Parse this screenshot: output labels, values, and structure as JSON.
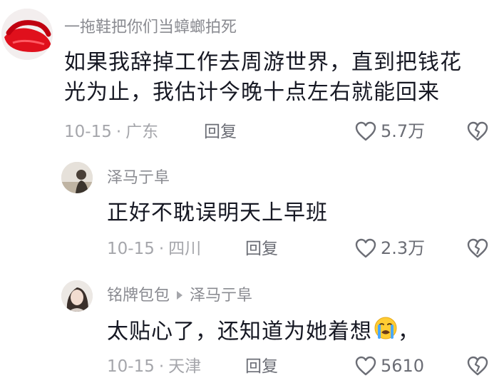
{
  "comments": [
    {
      "username": "一拖鞋把你们当蟑螂拍死",
      "content_line1": "如果我辞掉工作去周游世界，直到把钱花",
      "content_line2": "光为止，我估计今晚十点左右就能回来",
      "date": "10-15",
      "location": "广东",
      "reply_label": "回复",
      "likes": "5.7万"
    },
    {
      "username": "泽马亍阜",
      "content": "正好不耽误明天上早班",
      "date": "10-15",
      "location": "四川",
      "reply_label": "回复",
      "likes": "2.3万"
    },
    {
      "username": "铭牌包包",
      "reply_to": "泽马亍阜",
      "content": "太贴心了，还知道为她着想",
      "content_suffix": "，",
      "emoji": "crying-face-emoji",
      "date": "10-15",
      "location": "天津",
      "reply_label": "回复",
      "likes": "5610"
    }
  ],
  "separator": "·",
  "icons": {
    "like": "heart-outline-icon",
    "dislike": "broken-heart-outline-icon"
  },
  "colors": {
    "text": "#161823",
    "username": "#8a8b91",
    "meta": "#a5a6ab",
    "action": "#6b6d75"
  }
}
